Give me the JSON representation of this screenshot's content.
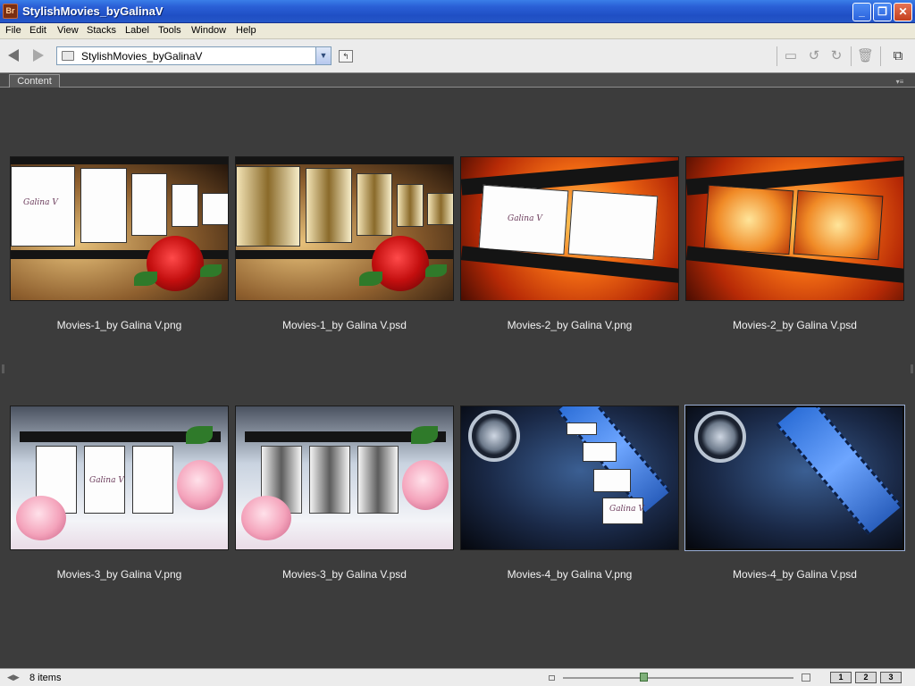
{
  "window": {
    "app_badge": "Br",
    "title": "StylishMovies_byGalinaV"
  },
  "menu": [
    "File",
    "Edit",
    "View",
    "Stacks",
    "Label",
    "Tools",
    "Window",
    "Help"
  ],
  "toolbar": {
    "path": "StylishMovies_byGalinaV"
  },
  "panel": {
    "tab_label": "Content"
  },
  "thumbnails": [
    {
      "caption": "Movies-1_by Galina V.png",
      "signature": "Galina V"
    },
    {
      "caption": "Movies-1_by Galina V.psd"
    },
    {
      "caption": "Movies-2_by Galina V.png",
      "signature": "Galina V"
    },
    {
      "caption": "Movies-2_by Galina V.psd"
    },
    {
      "caption": "Movies-3_by Galina V.png",
      "signature": "Galina V"
    },
    {
      "caption": "Movies-3_by Galina V.psd"
    },
    {
      "caption": "Movies-4_by Galina V.png",
      "signature": "Galina V"
    },
    {
      "caption": "Movies-4_by Galina V.psd",
      "selected": true
    }
  ],
  "status": {
    "item_count": "8 items",
    "zoom_level": 0.35,
    "view_buttons": [
      "1",
      "2",
      "3"
    ]
  }
}
